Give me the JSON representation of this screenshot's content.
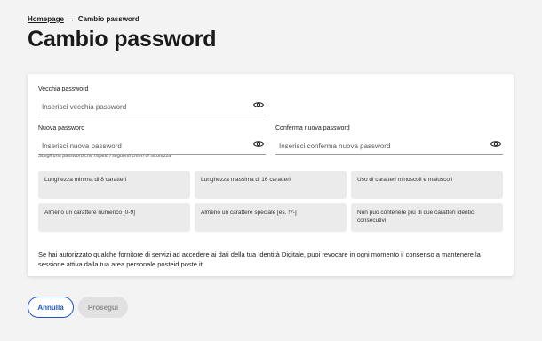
{
  "breadcrumb": {
    "home": "Homepage",
    "separator": "→",
    "current": "Cambio password"
  },
  "page": {
    "title": "Cambio password"
  },
  "form": {
    "old_password": {
      "label": "Vecchia password",
      "placeholder": "Inserisci vecchia password",
      "value": ""
    },
    "new_password": {
      "label": "Nuova password",
      "placeholder": "Inserisci nuova password",
      "value": ""
    },
    "confirm_password": {
      "label": "Conferma nuova password",
      "placeholder": "Inserisci conferma nuova password",
      "value": ""
    },
    "hint": "Scegli una password che rispetti i seguenti criteri di sicurezza"
  },
  "criteria": [
    "Lunghezza minima di 8 caratteri",
    "Lunghezza massima di 16 caratteri",
    "Uso di caratteri minuscoli e maiuscoli",
    "Almeno un carattere numerico [0-9]",
    "Almeno un carattere speciale [es. !?-]",
    "Non può contenere più di due caratteri identici consecutivi"
  ],
  "consent_text": "Se hai autorizzato qualche fornitore di servizi ad accedere ai dati della tua Identità Digitale, puoi revocare in ogni momento il consenso a mantenere la sessione attiva dalla tua area personale posteid.poste.it",
  "actions": {
    "cancel_label": "Annulla",
    "next_label": "Prosegui"
  },
  "icons": {
    "password_toggle": "eye-icon",
    "breadcrumb_separator": "arrow-right-icon"
  },
  "colors": {
    "primary": "#1f56c7",
    "background": "#f3f3f3",
    "criteria_bg": "#ebebeb",
    "disabled_bg": "#e1e1e1"
  }
}
